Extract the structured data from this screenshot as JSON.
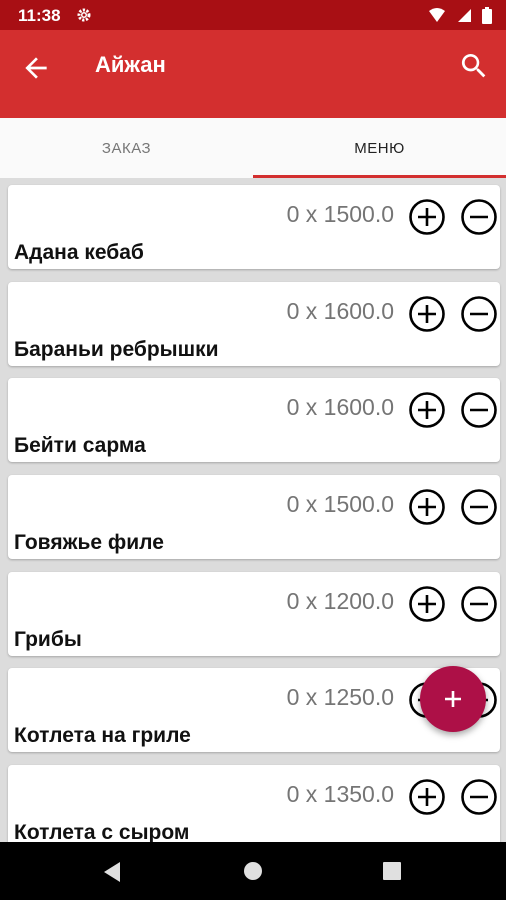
{
  "status_bar": {
    "time": "11:38",
    "icons": [
      "gear-icon",
      "wifi-icon",
      "signal-icon",
      "battery-icon"
    ]
  },
  "app_bar": {
    "title": "Айжан",
    "back_icon": "arrow-back-icon",
    "search_icon": "search-icon",
    "color": "#d32f2f"
  },
  "tabs": [
    {
      "label": "ЗАКАЗ",
      "selected": false
    },
    {
      "label": "МЕНЮ",
      "selected": true
    }
  ],
  "menu_items": [
    {
      "name": "Адана кебаб",
      "quantity_price": "0 x 1500.0"
    },
    {
      "name": "Бараньи ребрышки",
      "quantity_price": "0 x 1600.0"
    },
    {
      "name": "Бейти сарма",
      "quantity_price": "0 x 1600.0"
    },
    {
      "name": "Говяжье филе",
      "quantity_price": "0 x 1500.0"
    },
    {
      "name": "Грибы",
      "quantity_price": "0 x 1200.0"
    },
    {
      "name": "Котлета на гриле",
      "quantity_price": "0 x 1250.0"
    },
    {
      "name": "Котлета с сыром",
      "quantity_price": "0 x 1350.0"
    }
  ],
  "fab": {
    "icon": "plus-icon",
    "color": "#ad1047"
  },
  "nav_bar": {
    "icons": [
      "nav-back-icon",
      "nav-home-icon",
      "nav-recent-icon"
    ]
  }
}
